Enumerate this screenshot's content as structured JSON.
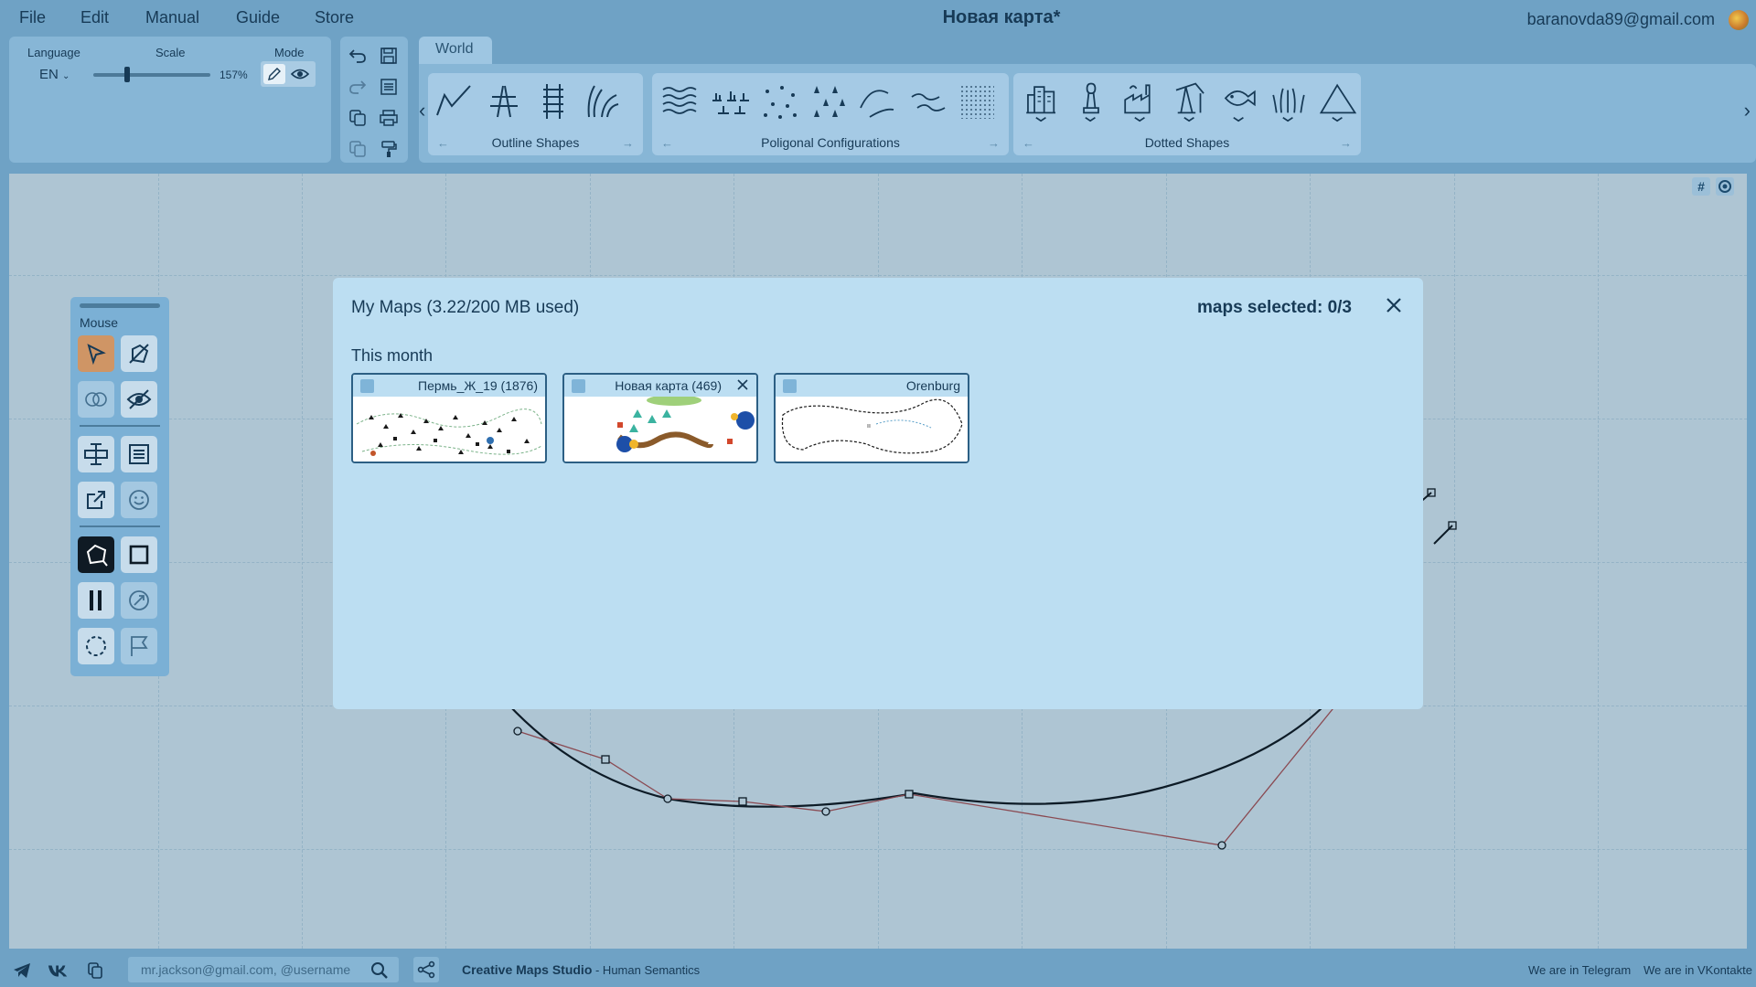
{
  "menu": {
    "file": "File",
    "edit": "Edit",
    "manual": "Manual",
    "guide": "Guide",
    "store": "Store"
  },
  "app": {
    "title": "Новая карта*",
    "user_email": "baranovda89@gmail.com"
  },
  "settings": {
    "language_label": "Language",
    "language_value": "EN",
    "scale_label": "Scale",
    "scale_value": "157%",
    "scale_fraction": 0.3,
    "mode_label": "Mode"
  },
  "palette": {
    "tab": "World",
    "groups": {
      "outline": "Outline Shapes",
      "polygonal": "Poligonal Configurations",
      "dotted": "Dotted Shapes"
    }
  },
  "canvas_tools": {
    "grid_icon": "#"
  },
  "toolbox": {
    "title": "Mouse"
  },
  "dialog": {
    "title": "My Maps (3.22/200 MB used)",
    "selected": "maps selected: 0/3",
    "section": "This month",
    "maps": [
      {
        "name": "Пермь_Ж_19 (1876)"
      },
      {
        "name": "Новая карта (469)"
      },
      {
        "name": "Orenburg"
      }
    ]
  },
  "statusbar": {
    "search_placeholder": "mr.jackson@gmail.com, @username",
    "brand_name": "Creative Maps Studio",
    "brand_suffix": " - Human Semantics",
    "telegram": "We are in Telegram",
    "vk": "We are in VKontakte"
  },
  "colors": {
    "accent": "#cf9565",
    "background": "#6fa2c5",
    "dialog": "#bcdef2",
    "canvas": "#aec5d3"
  }
}
